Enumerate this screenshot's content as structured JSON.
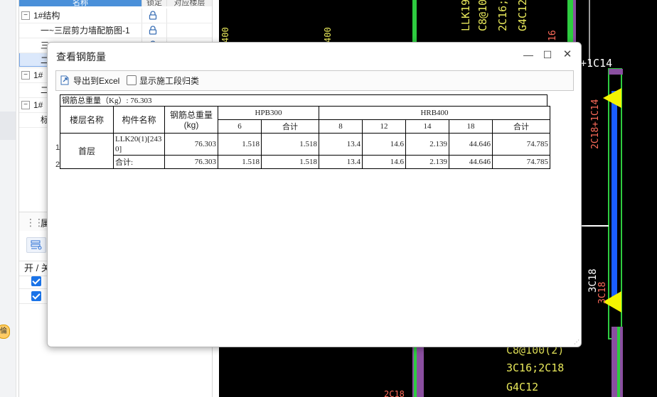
{
  "tree": {
    "headers": [
      "名称",
      "锁定",
      "对应楼层"
    ],
    "rows": [
      {
        "toggle": "−",
        "text": "1#结构",
        "lock": true
      },
      {
        "toggle": "",
        "text": "一~三层剪力墙配筋图-1",
        "lock": true
      },
      {
        "toggle": "",
        "text": "三",
        "lock": true
      },
      {
        "toggle": "",
        "text": "二",
        "lock": false
      },
      {
        "toggle": "−",
        "text": "1#",
        "lock": false
      },
      {
        "toggle": "",
        "text": "二",
        "lock": false
      },
      {
        "toggle": "−",
        "text": "1#",
        "lock": false
      },
      {
        "toggle": "",
        "text": "标",
        "lock": false
      }
    ]
  },
  "properties": {
    "title": "属",
    "col_label": "开 / 关",
    "checks": [
      true,
      true
    ]
  },
  "left_strip": {
    "badge": "倫"
  },
  "cad": {
    "texts": [
      "LLK19",
      "C8@10",
      "2C16;2",
      "G4C12",
      "16",
      "+1C14",
      "2C18+1C14",
      "3C18",
      "3C18",
      "C8@100(2)",
      "3C16;2C18",
      "G4C12",
      "400",
      "400",
      "2C18"
    ]
  },
  "dialog": {
    "title": "查看钢筋量",
    "minimize": "—",
    "maximize": "☐",
    "close": "✕",
    "export_label": "导出到Excel",
    "show_segment_label": "显示施工段归类",
    "show_segment_checked": false
  },
  "report": {
    "total_line": "钢筋总重量（Kg）: 76.303",
    "headers": {
      "floor": "楼层名称",
      "component": "构件名称",
      "total_weight": "钢筋总重量(kg)",
      "hpb": "HPB300",
      "hrb": "HRB400",
      "hpb_cols": [
        "6",
        "合计"
      ],
      "hrb_cols": [
        "8",
        "12",
        "14",
        "18",
        "合计"
      ]
    },
    "row_numbers": [
      "1",
      "2"
    ],
    "floor": "首层",
    "rows": [
      {
        "component": "LLK20(1)[2430]",
        "total": "76.303",
        "hpb6": "1.518",
        "hpb_sum": "1.518",
        "h8": "13.4",
        "h12": "14.6",
        "h14": "2.139",
        "h18": "44.646",
        "hrb_sum": "74.785"
      },
      {
        "component": "合计:",
        "total": "76.303",
        "hpb6": "1.518",
        "hpb_sum": "1.518",
        "h8": "13.4",
        "h12": "14.6",
        "h14": "2.139",
        "h18": "44.646",
        "hrb_sum": "74.785"
      }
    ]
  },
  "colors": {
    "accent": "#4a90d9",
    "cad_bg": "#000000",
    "cad_yellow": "#e8e85a",
    "cad_green": "#2ecc40",
    "cad_blue": "#1a5cff"
  }
}
